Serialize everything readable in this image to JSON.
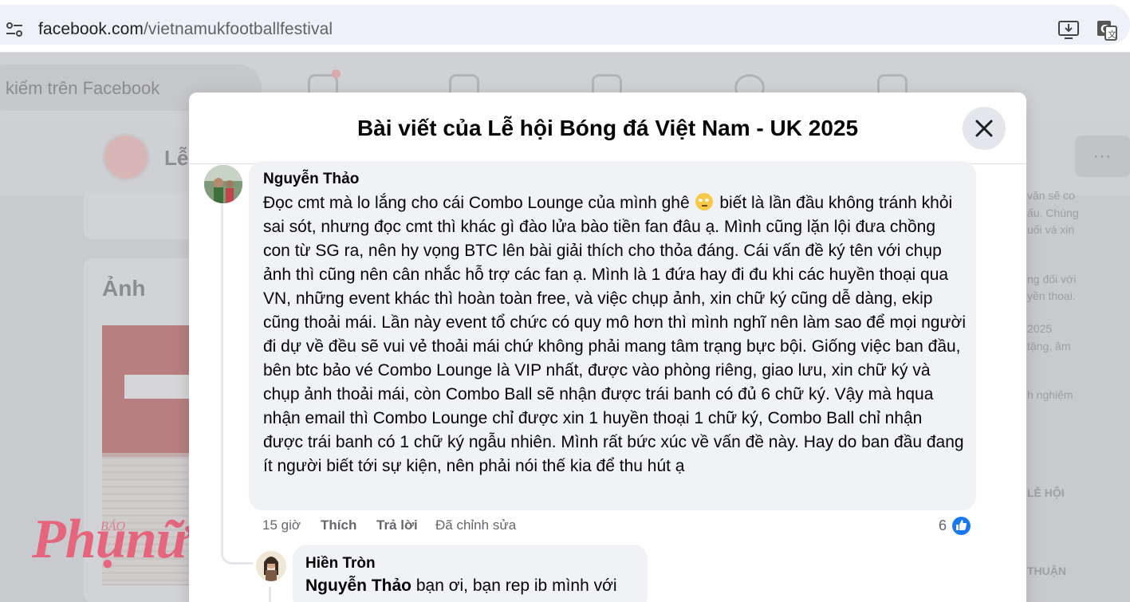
{
  "browser": {
    "url_host": "facebook.com",
    "url_path": "/vietnamukfootballfestival",
    "site_icon": "tune-icon",
    "install_icon": "install-app-icon",
    "translate_icon": "translate-icon"
  },
  "background": {
    "search_placeholder": "kiếm trên Facebook",
    "page_initial": "Lễ",
    "more_label": "···",
    "photos_title": "Ảnh",
    "watermark_small": "BÁO",
    "watermark": "Phụnữ",
    "right_snippets": [
      "văn sẽ co",
      "ấu. Chúng",
      "uối và xin",
      "ng đối với",
      "yền thoại.",
      "2025",
      "tặng, âm",
      "h nghiệm",
      "LỄ HỘI",
      "THUẬN"
    ]
  },
  "dialog": {
    "title": "Bài viết của Lễ hội Bóng đá Việt Nam - UK 2025",
    "close_icon": "close-icon"
  },
  "comment": {
    "author": "Nguyễn Thảo",
    "text_part1": "Đọc cmt mà lo lắng cho cái Combo Lounge của mình ghê",
    "text_part2": "biết là lần đầu không tránh khỏi sai sót, nhưng đọc cmt thì khác gì đào lửa bào tiền fan đâu ạ. Mình cũng lặn lội đưa chồng con từ SG ra, nên hy vọng BTC lên bài giải thích cho thỏa đáng. Cái vấn đề ký tên với chụp ảnh thì cũng nên cân nhắc hỗ trợ các fan ạ. Mình là 1 đứa hay đi đu khi các huyền thoại qua VN, những event khác thì hoàn toàn free, và việc chụp ảnh, xin chữ ký cũng dễ dàng, ekip cũng thoải mái. Lần này event tổ chức có quy mô hơn thì mình nghĩ nên làm sao để mọi người đi dự về đều sẽ vui vẻ thoải mái chứ không phải mang tâm trạng bực bội. Giống việc ban đầu, bên btc bảo vé Combo Lounge là VIP nhất, được vào phòng riêng, giao lưu, xin chữ ký và chụp ảnh thoải mái, còn Combo Ball sẽ nhận được trái banh có đủ 6 chữ ký. Vậy mà hqua nhận email thì Combo Lounge chỉ được xin 1 huyền thoại 1 chữ ký, Combo Ball chỉ nhận được trái banh có 1 chữ ký ngẫu nhiên. Mình rất bức xúc về vấn đề này. Hay do ban đầu đang ít người biết tới sự kiện, nên phải nói thế kia để thu hút ạ",
    "emoji_icon": "rolling-eyes-emoji",
    "time": "15 giờ",
    "like_label": "Thích",
    "reply_label": "Trả lời",
    "edited_label": "Đã chỉnh sửa",
    "like_count": "6",
    "like_badge_icon": "thumbs-up-icon"
  },
  "reply": {
    "author": "Hiền Tròn",
    "mention": "Nguyễn Thảo",
    "text": "bạn ơi, bạn rep ib mình với"
  }
}
